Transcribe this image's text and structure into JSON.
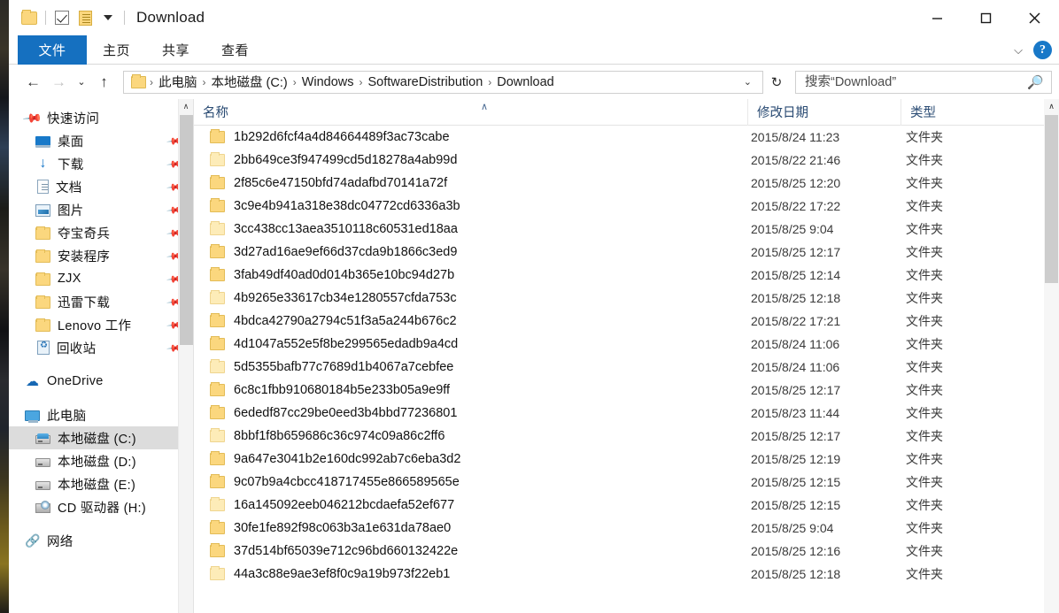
{
  "window": {
    "title": "Download",
    "quick_access": [
      "folder-icon",
      "checkbox-icon",
      "properties-icon",
      "dropdown-caret-icon"
    ],
    "minimize_label": "—",
    "maximize_label": "☐",
    "close_label": "✕"
  },
  "ribbon": {
    "tabs": [
      {
        "label": "文件",
        "active": true
      },
      {
        "label": "主页",
        "active": false
      },
      {
        "label": "共享",
        "active": false
      },
      {
        "label": "查看",
        "active": false
      }
    ],
    "expand_icon": "chevron-down-icon",
    "help_label": "?"
  },
  "address": {
    "back_icon": "←",
    "forward_icon": "→",
    "recent_icon": "⌄",
    "up_icon": "↑",
    "separator": "›",
    "crumbs": [
      "此电脑",
      "本地磁盘 (C:)",
      "Windows",
      "SoftwareDistribution",
      "Download"
    ],
    "crumb_dropdown_icon": "⌄",
    "refresh_icon": "↻"
  },
  "search": {
    "placeholder": "搜索“Download”",
    "value": "",
    "icon": "search-icon"
  },
  "sidebar": {
    "groups": [
      {
        "header": {
          "label": "快速访问",
          "icon": "pin-icon",
          "pinned": false
        },
        "items": [
          {
            "label": "桌面",
            "icon": "desktop-icon",
            "pinned": true
          },
          {
            "label": "下载",
            "icon": "download-icon",
            "pinned": true
          },
          {
            "label": "文档",
            "icon": "documents-icon",
            "pinned": true
          },
          {
            "label": "图片",
            "icon": "pictures-icon",
            "pinned": true
          },
          {
            "label": "夺宝奇兵",
            "icon": "folder-icon",
            "pinned": true
          },
          {
            "label": "安装程序",
            "icon": "folder-icon",
            "pinned": true
          },
          {
            "label": "ZJX",
            "icon": "folder-icon",
            "pinned": true
          },
          {
            "label": "迅雷下载",
            "icon": "folder-icon",
            "pinned": true
          },
          {
            "label": "Lenovo 工作",
            "icon": "folder-icon",
            "pinned": true
          },
          {
            "label": "回收站",
            "icon": "recycle-bin-icon",
            "pinned": true
          }
        ]
      },
      {
        "header": {
          "label": "OneDrive",
          "icon": "onedrive-icon",
          "pinned": false
        },
        "items": []
      },
      {
        "header": {
          "label": "此电脑",
          "icon": "this-pc-icon",
          "pinned": false
        },
        "items": [
          {
            "label": "本地磁盘 (C:)",
            "icon": "system-drive-icon",
            "pinned": false,
            "selected": true
          },
          {
            "label": "本地磁盘 (D:)",
            "icon": "drive-icon",
            "pinned": false,
            "selected": false
          },
          {
            "label": "本地磁盘 (E:)",
            "icon": "drive-icon",
            "pinned": false,
            "selected": false
          },
          {
            "label": "CD 驱动器 (H:)",
            "icon": "cd-drive-icon",
            "pinned": false,
            "selected": false
          }
        ]
      },
      {
        "header": {
          "label": "网络",
          "icon": "network-icon",
          "pinned": false
        },
        "items": []
      }
    ]
  },
  "filelist": {
    "columns": [
      {
        "key": "name",
        "label": "名称",
        "sorted": "asc"
      },
      {
        "key": "date",
        "label": "修改日期",
        "sorted": ""
      },
      {
        "key": "type",
        "label": "类型",
        "sorted": ""
      }
    ],
    "sort_arrow": "∧",
    "rows": [
      {
        "name": "1b292d6fcf4a4d84664489f3ac73cabe",
        "date": "2015/8/24 11:23",
        "type": "文件夹"
      },
      {
        "name": "2bb649ce3f947499cd5d18278a4ab99d",
        "date": "2015/8/22 21:46",
        "type": "文件夹"
      },
      {
        "name": "2f85c6e47150bfd74adafbd70141a72f",
        "date": "2015/8/25 12:20",
        "type": "文件夹"
      },
      {
        "name": "3c9e4b941a318e38dc04772cd6336a3b",
        "date": "2015/8/22 17:22",
        "type": "文件夹"
      },
      {
        "name": "3cc438cc13aea3510118c60531ed18aa",
        "date": "2015/8/25 9:04",
        "type": "文件夹"
      },
      {
        "name": "3d27ad16ae9ef66d37cda9b1866c3ed9",
        "date": "2015/8/25 12:17",
        "type": "文件夹"
      },
      {
        "name": "3fab49df40ad0d014b365e10bc94d27b",
        "date": "2015/8/25 12:14",
        "type": "文件夹"
      },
      {
        "name": "4b9265e33617cb34e1280557cfda753c",
        "date": "2015/8/25 12:18",
        "type": "文件夹"
      },
      {
        "name": "4bdca42790a2794c51f3a5a244b676c2",
        "date": "2015/8/22 17:21",
        "type": "文件夹"
      },
      {
        "name": "4d1047a552e5f8be299565edadb9a4cd",
        "date": "2015/8/24 11:06",
        "type": "文件夹"
      },
      {
        "name": "5d5355bafb77c7689d1b4067a7cebfee",
        "date": "2015/8/24 11:06",
        "type": "文件夹"
      },
      {
        "name": "6c8c1fbb910680184b5e233b05a9e9ff",
        "date": "2015/8/25 12:17",
        "type": "文件夹"
      },
      {
        "name": "6ededf87cc29be0eed3b4bbd77236801",
        "date": "2015/8/23 11:44",
        "type": "文件夹"
      },
      {
        "name": "8bbf1f8b659686c36c974c09a86c2ff6",
        "date": "2015/8/25 12:17",
        "type": "文件夹"
      },
      {
        "name": "9a647e3041b2e160dc992ab7c6eba3d2",
        "date": "2015/8/25 12:19",
        "type": "文件夹"
      },
      {
        "name": "9c07b9a4cbcc418717455e866589565e",
        "date": "2015/8/25 12:15",
        "type": "文件夹"
      },
      {
        "name": "16a145092eeb046212bcdaefa52ef677",
        "date": "2015/8/25 12:15",
        "type": "文件夹"
      },
      {
        "name": "30fe1fe892f98c063b3a1e631da78ae0",
        "date": "2015/8/25 9:04",
        "type": "文件夹"
      },
      {
        "name": "37d514bf65039e712c96bd660132422e",
        "date": "2015/8/25 12:16",
        "type": "文件夹"
      },
      {
        "name": "44a3c88e9ae3ef8f0c9a19b973f22eb1",
        "date": "2015/8/25 12:18",
        "type": "文件夹"
      }
    ]
  },
  "scrollbars": {
    "up_arrow": "∧"
  },
  "colors": {
    "accent": "#1570c0",
    "selection": "#dcdcdc",
    "folder": "#fbd77e",
    "header_text": "#2a4b73"
  }
}
